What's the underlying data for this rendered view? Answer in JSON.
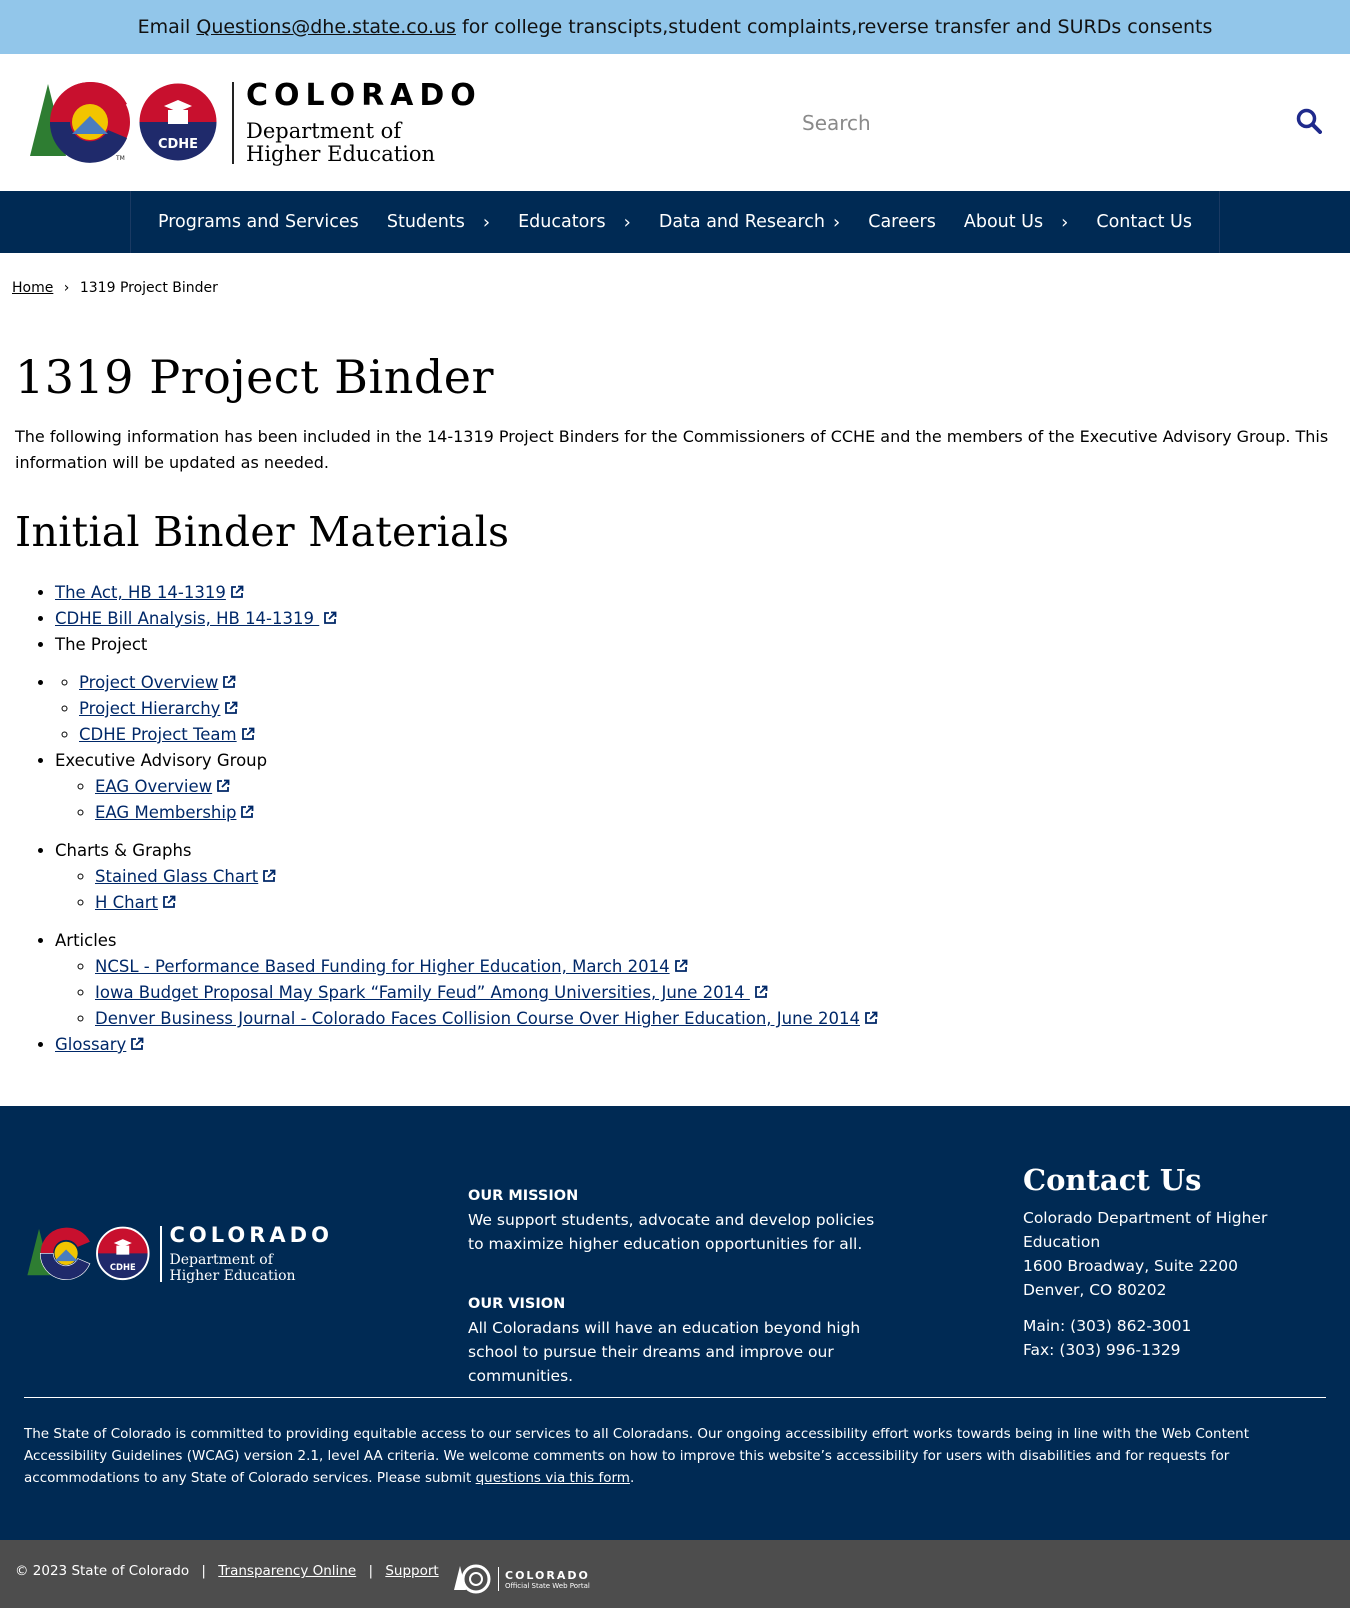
{
  "alert": {
    "prefix": "Email ",
    "email": "Questions@dhe.state.co.us",
    "suffix": " for college transcipts,student complaints,reverse transfer and SURDs consents"
  },
  "header": {
    "logo_colorado": "COLORADO",
    "logo_dept_line1": "Department of",
    "logo_dept_line2": "Higher Education",
    "logo_badge": "CDHE",
    "search_placeholder": "Search"
  },
  "nav": {
    "items": [
      {
        "label": "Programs and Services",
        "has_submenu": false
      },
      {
        "label": "Students",
        "has_submenu": true
      },
      {
        "label": "Educators",
        "has_submenu": true
      },
      {
        "label": "Data and Research",
        "has_submenu": true
      },
      {
        "label": "Careers",
        "has_submenu": false
      },
      {
        "label": "About Us",
        "has_submenu": true
      },
      {
        "label": "Contact Us",
        "has_submenu": false
      }
    ],
    "chevron": "›"
  },
  "breadcrumb": {
    "home": "Home",
    "separator": "›",
    "current": "1319 Project Binder"
  },
  "page": {
    "title": "1319 Project Binder",
    "intro": "The following information has been included in the 14-1319 Project Binders for the Commissioners of CCHE and the members of the Executive Advisory Group.  This information will be updated as needed.",
    "section_title": "Initial Binder Materials"
  },
  "materials": {
    "act": "The Act, HB 14-1319",
    "bill_analysis": "CDHE Bill Analysis, HB 14-1319 ",
    "project": {
      "label": "The Project",
      "links": [
        "Project Overview",
        "Project Hierarchy",
        "CDHE Project Team"
      ]
    },
    "eag": {
      "label": "Executive Advisory Group",
      "links": [
        "EAG Overview",
        "EAG Membership"
      ]
    },
    "charts": {
      "label": "Charts & Graphs",
      "links": [
        "Stained Glass Chart",
        "H Chart"
      ]
    },
    "articles": {
      "label": "Articles",
      "links": [
        "NCSL - Performance Based Funding for Higher Education, March 2014",
        "Iowa Budget Proposal May Spark “Family Feud” Among Universities, June 2014 ",
        "Denver Business Journal - Colorado Faces Collision Course Over Higher Education, June 2014"
      ]
    },
    "glossary": "Glossary"
  },
  "footer": {
    "mission_heading": "OUR MISSION",
    "mission_text": "We support students, advocate and develop policies to maximize higher education opportunities for all.",
    "vision_heading": "OUR VISION",
    "vision_text": "All Coloradans will have an education beyond high school to pursue their dreams and improve our communities.",
    "contact_heading": "Contact Us",
    "address_line1": "Colorado Department of Higher Education",
    "address_line2": "1600 Broadway, Suite 2200",
    "address_line3": "Denver, CO 80202",
    "main_phone": "Main: (303) 862-3001",
    "fax": "Fax: (303) 996-1329",
    "a11y_text": "The State of Colorado is committed to providing equitable access to our services to all Coloradans. Our ongoing accessibility effort works towards being in line with the Web Content Accessibility Guidelines (WCAG) version 2.1, level AA criteria. We welcome comments on how to improve this website’s accessibility for users with disabilities and for requests for accommodations to any State of Colorado services. Please submit ",
    "a11y_link": "questions via this form",
    "a11y_end": "."
  },
  "bottom": {
    "copyright": "© 2023 State of Colorado",
    "sep": "|",
    "transparency": "Transparency Online",
    "support": "Support",
    "portal_name": "COLORADO",
    "portal_sub": "Official State Web Portal"
  },
  "colors": {
    "alert_bg": "#92c6ea",
    "nav_bg": "#002a54",
    "footer_bg": "#002a54",
    "bottom_bg": "#4d4d4d",
    "link": "#002868"
  }
}
